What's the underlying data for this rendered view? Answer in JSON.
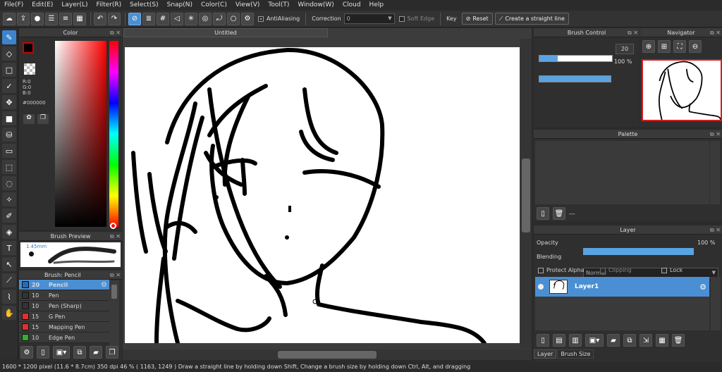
{
  "menu": [
    "File(F)",
    "Edit(E)",
    "Layer(L)",
    "Filter(R)",
    "Select(S)",
    "Snap(N)",
    "Color(C)",
    "View(V)",
    "Tool(T)",
    "Window(W)",
    "Cloud",
    "Help"
  ],
  "toolbar": {
    "antialiasing_label": "AntiAliasing",
    "correction_label": "Correction",
    "correction_value": "0",
    "soft_edge_label": "Soft Edge",
    "key_label": "Key",
    "reset_label": "Reset",
    "straight_line_label": "Create a straight line"
  },
  "color_panel": {
    "title": "Color",
    "r": "R:0",
    "g": "G:0",
    "b": "B:0",
    "hex": "#000000",
    "fg_color": "#000000"
  },
  "brush_preview": {
    "title": "Brush Preview",
    "size": "1.45mm"
  },
  "brush_list": {
    "title": "Brush: Pencil",
    "items": [
      {
        "size": "20",
        "name": "Pencil",
        "color": "#2a6ab0"
      },
      {
        "size": "10",
        "name": "Pen",
        "color": "#333333"
      },
      {
        "size": "10",
        "name": "Pen (Sharp)",
        "color": "#333333"
      },
      {
        "size": "15",
        "name": "G Pen",
        "color": "#e03030"
      },
      {
        "size": "15",
        "name": "Mapping Pen",
        "color": "#e03030"
      },
      {
        "size": "10",
        "name": "Edge Pen",
        "color": "#30b030"
      }
    ]
  },
  "canvas": {
    "tab_title": "Untitled"
  },
  "brush_control": {
    "title": "Brush Control",
    "size_value": "20",
    "opacity_value": "100 %",
    "size_fraction": 0.25,
    "opacity_fraction": 1.0
  },
  "navigator": {
    "title": "Navigator"
  },
  "palette": {
    "title": "Palette",
    "footer": "---"
  },
  "layer_panel": {
    "title": "Layer",
    "opacity_label": "Opacity",
    "opacity_value": "100 %",
    "blending_label": "Blending",
    "blending_value": "Normal",
    "protect_alpha": "Protect Alpha",
    "clipping": "Clipping",
    "lock": "Lock",
    "layer_name": "Layer1",
    "tab_layer": "Layer",
    "tab_brush_size": "Brush Size"
  },
  "status_bar": "1600 * 1200 pixel  (11.6 * 8.7cm)  350 dpi  46 %  ( 1163, 1249 )  Draw a straight line by holding down Shift, Change a brush size by holding down Ctrl, Alt, and dragging"
}
